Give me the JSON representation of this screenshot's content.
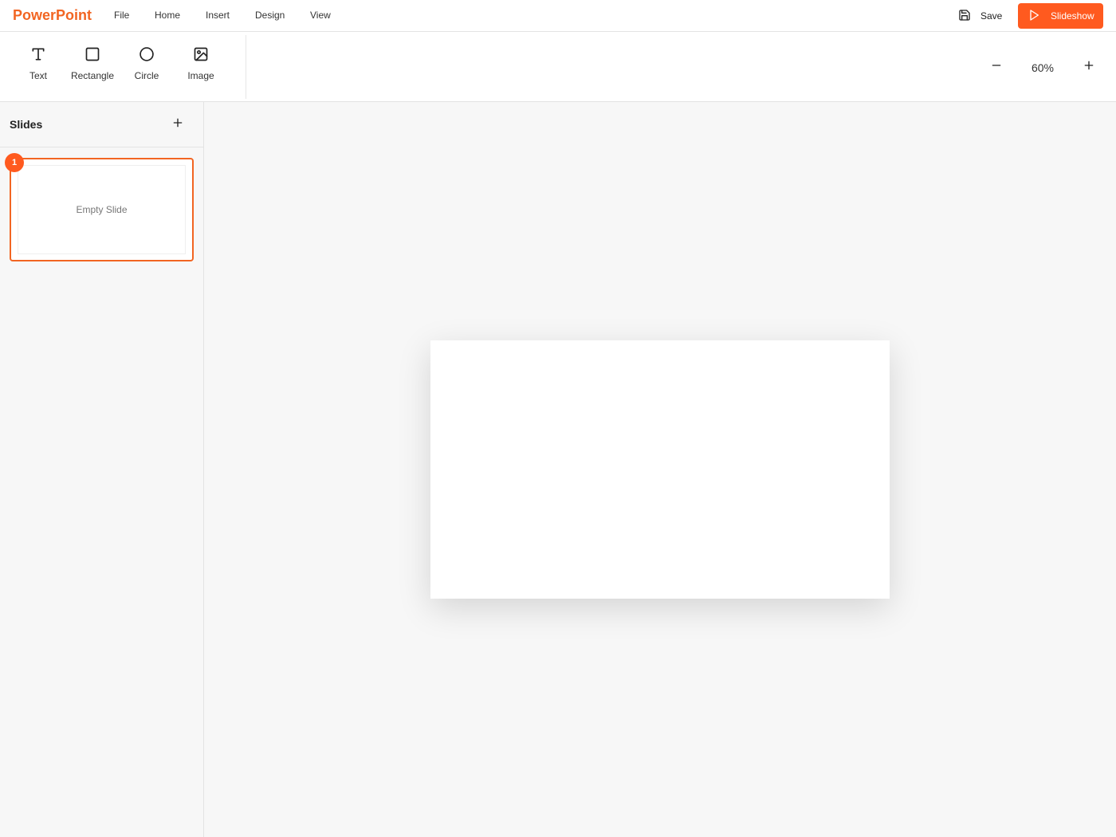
{
  "app": {
    "title": "PowerPoint"
  },
  "menu": [
    "File",
    "Home",
    "Insert",
    "Design",
    "View"
  ],
  "actions": {
    "save_label": "Save",
    "slideshow_label": "Slideshow"
  },
  "toolbar": {
    "tools": [
      {
        "label": "Text",
        "icon": "text-icon"
      },
      {
        "label": "Rectangle",
        "icon": "rectangle-icon"
      },
      {
        "label": "Circle",
        "icon": "circle-icon"
      },
      {
        "label": "Image",
        "icon": "image-icon"
      }
    ],
    "zoom": "60%"
  },
  "sidebar": {
    "title": "Slides",
    "slides": [
      {
        "number": "1",
        "preview_text": "Empty Slide",
        "selected": true
      }
    ]
  },
  "colors": {
    "accent": "#ff5a1f",
    "brand": "#f26522",
    "background": "#f7f7f7"
  }
}
